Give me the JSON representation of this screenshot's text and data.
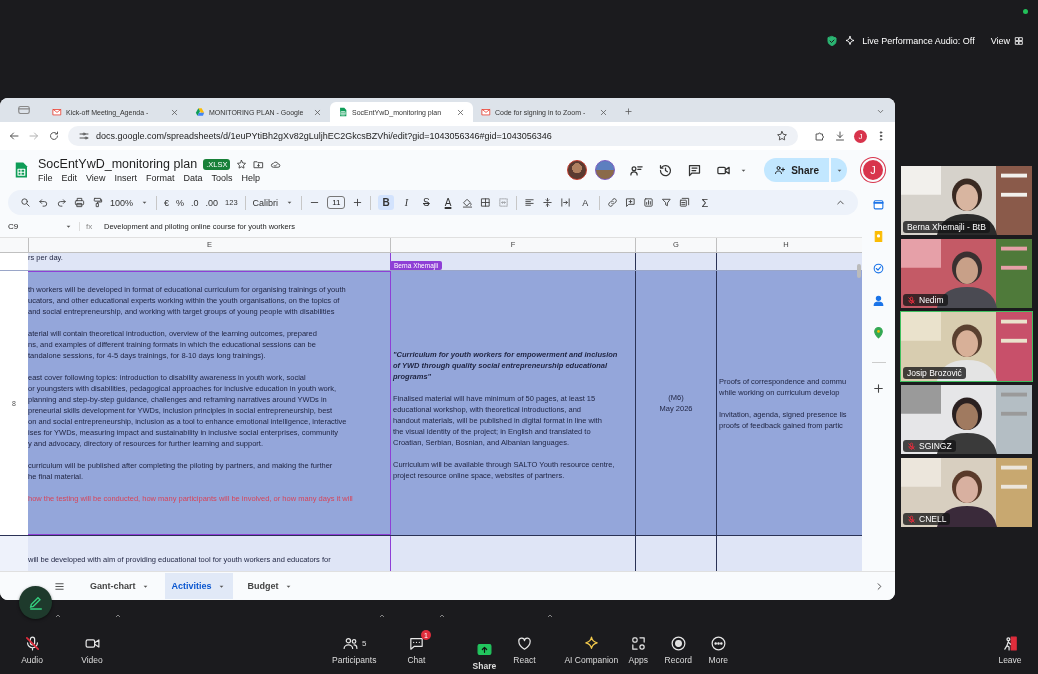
{
  "meeting_bar": {
    "status": "Live Performance Audio: Off",
    "view_button": "View"
  },
  "browser": {
    "tabs": [
      {
        "title": "Kick-off Meeting_Agenda -",
        "kind": "mail",
        "selected": false
      },
      {
        "title": "MONITORING PLAN - Google",
        "kind": "drive",
        "selected": false
      },
      {
        "title": "SocEntYwD_monitoring plan",
        "kind": "sheets",
        "selected": true
      },
      {
        "title": "Code for signing in to Zoom -",
        "kind": "mail",
        "selected": false
      }
    ],
    "url": "docs.google.com/spreadsheets/d/1euPYtiBh2gXv82gLuljhEC2GkcsBZVhi/edit?gid=1043056346#gid=1043056346",
    "profile_initial": "J"
  },
  "sheet": {
    "title": "SocEntYwD_monitoring plan",
    "file_badge": ".XLSX",
    "menu": [
      "File",
      "Edit",
      "View",
      "Insert",
      "Format",
      "Data",
      "Tools",
      "Help"
    ],
    "share_button": "Share",
    "account_initial": "J",
    "toolbar": {
      "zoom": "100%",
      "currency": "€",
      "percent": "%",
      "decimal_decrease": ".0",
      "decimal_increase": ".00",
      "number_format": "123",
      "font": "Calibri",
      "font_size": "11",
      "bold": {
        "label": "B",
        "on": true
      },
      "italic": {
        "label": "I",
        "on": false
      },
      "strikethrough": "S",
      "text_color": "A",
      "text_rotation": "A",
      "sum": "Σ"
    },
    "name_box": "C9",
    "function_label": "fx",
    "formula": "Development and piloting online course for youth workers",
    "columns": [
      "E",
      "F",
      "G",
      "H"
    ],
    "collaborator": {
      "name": "Berna Xhemajli",
      "color": "#8e3fd6"
    },
    "rows": [
      {
        "selected": false,
        "e": [
          {
            "lines": [
              "rs per day."
            ]
          }
        ]
      },
      {
        "number": "8",
        "selected": true,
        "e": [
          {
            "lines": [
              "th workers will be developed in format of educational curriculum for organising trainings of youth",
              "ucators, and other educational experts working within the youth organisations, on the topics of",
              "and social entrepreneurship, and working with target groups of young people with disabilities"
            ]
          },
          {
            "lines": [
              "aterial will contain theoretical introduction, overview of the learning outcomes, prepared",
              "ns, and examples of different training formats in which the educational sessions can be",
              "tandalone sessions, for 4-5 days trainings, for 8-10 days long trainings)."
            ]
          },
          {
            "lines": [
              "east cover following topics: introduction to disability awareness in youth work, social",
              "or youngsters with disabilities, pedagogical approaches for inclusive education in youth work,",
              "planning and step-by-step guidance, challenges and reframing narratives around YWDs in",
              "preneurial skills development for YWDs, inclusion principles in social entrepreneurship, best",
              "on and social entrepreneurship, inclusion as a tool to enhance emotional intelligence, interactive",
              "ises for YWDs, measuring impact and sustainability in inclusive social enterprises, community",
              "y and advocacy, directory of resources for further learning and support."
            ]
          },
          {
            "lines": [
              "curriculum will be published after completing the piloting by partners, and making the further",
              "he final material."
            ]
          },
          {
            "kind": "note",
            "lines": [
              "how the testing will be conducted, how many participants will be involved, or how many days it will"
            ]
          }
        ],
        "f": [
          {
            "kind": "title",
            "lines": [
              "\"Curriculum for youth workers for empowerment and inclusion",
              "of YWD through quality social entrepreneurship educational",
              "programs\""
            ]
          },
          {
            "lines": [
              "Finalised material will have minimum of 50 pages, at least 15",
              "educational workshop, with theoretical introductions, and",
              "handout materials, will be published in digital format in line with",
              "the visual identity of the project; in English and translated to",
              "Croatian, Serbian, Bosnian, and Albanian languages."
            ]
          },
          {
            "lines": [
              "Curriculum will be available through SALTO Youth resource centre,",
              "project resource online space, websites of partners."
            ]
          }
        ],
        "g": [
          {
            "lines": [
              "(M6)",
              "May 2026"
            ]
          }
        ],
        "h": [
          {
            "lines": [
              "Proofs of correspondence and commu",
              "while working on curriculum develop"
            ]
          },
          {
            "lines": [
              "Invitation, agenda, signed presence lis",
              "proofs of feedback gained from partic"
            ]
          }
        ]
      },
      {
        "selected": false,
        "e": [
          {
            "lines": [
              "will be developed with aim of providing educational tool for youth workers and educators for"
            ]
          }
        ]
      }
    ]
  },
  "sheet_tabs": [
    {
      "label": "Gant-chart",
      "selected": false
    },
    {
      "label": "Activities",
      "selected": true
    },
    {
      "label": "Budget",
      "selected": false
    }
  ],
  "participants": [
    {
      "name": "Berna Xhemajli - BtB",
      "muted": false,
      "speaking": false
    },
    {
      "name": "Nedim",
      "muted": true,
      "speaking": false
    },
    {
      "name": "Josip Brozović",
      "muted": false,
      "speaking": true
    },
    {
      "name": "SGINGZ",
      "muted": true,
      "speaking": false
    },
    {
      "name": "CNELL",
      "muted": true,
      "speaking": false
    }
  ],
  "controls": [
    {
      "kind": "audio",
      "label": "Audio",
      "muted": true,
      "menu": true
    },
    {
      "kind": "video",
      "label": "Video",
      "menu": true
    },
    {
      "kind": "participants",
      "label": "Participants",
      "count": "5",
      "menu": true
    },
    {
      "kind": "chat",
      "label": "Chat",
      "badge": "1",
      "menu": true
    },
    {
      "kind": "share",
      "label": "Share"
    },
    {
      "kind": "react",
      "label": "React",
      "menu": true
    },
    {
      "kind": "ai-companion",
      "label": "AI Companion"
    },
    {
      "kind": "apps",
      "label": "Apps"
    },
    {
      "kind": "record",
      "label": "Record"
    },
    {
      "kind": "more",
      "label": "More"
    },
    {
      "kind": "leave",
      "label": "Leave"
    }
  ]
}
